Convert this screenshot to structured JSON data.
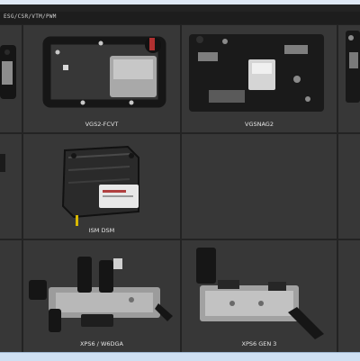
{
  "window": {
    "title": "ESG/CSR/VTM/PWM"
  },
  "modules": [
    {
      "id": "left-partial-top",
      "label": ""
    },
    {
      "id": "vgs2-fcvt",
      "label": "VGS2-FCVT"
    },
    {
      "id": "vgsnag2",
      "label": "VGSNAG2"
    },
    {
      "id": "right-partial-top",
      "label": ""
    },
    {
      "id": "left-partial-middle",
      "label": ""
    },
    {
      "id": "ism-dsm",
      "label": "ISM DSM"
    },
    {
      "id": "empty-a",
      "label": ""
    },
    {
      "id": "empty-b",
      "label": ""
    },
    {
      "id": "left-partial-bottom",
      "label": ""
    },
    {
      "id": "xps6-w6dga",
      "label": "XPS6 / W6DGA"
    },
    {
      "id": "xps6-gen3",
      "label": "XPS6 GEN 3"
    },
    {
      "id": "right-partial-bottom",
      "label": ""
    }
  ],
  "colors": {
    "background": "#232323",
    "tile": "#373737",
    "caption_text": "#e4e4e4",
    "module_metal": "#9a9a9a",
    "module_dark": "#1a1a1a"
  }
}
